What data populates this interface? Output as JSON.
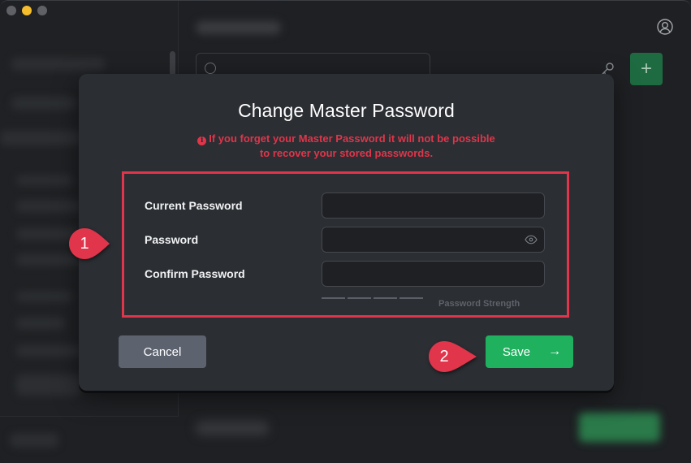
{
  "window": {
    "traffic_lights": [
      "close",
      "minimize",
      "maximize"
    ]
  },
  "background": {
    "icons": {
      "search": "search-icon",
      "user": "user-circle-icon",
      "key": "key-icon",
      "add": "plus-icon"
    },
    "add_button_label": "+"
  },
  "modal": {
    "title": "Change Master Password",
    "warning_icon": "i",
    "warning_line1": "If you forget your Master Password it will not be possible",
    "warning_line2": "to recover your stored passwords.",
    "fields": [
      {
        "label": "Current Password",
        "value": "",
        "placeholder": ""
      },
      {
        "label": "Password",
        "value": "",
        "placeholder": ""
      },
      {
        "label": "Confirm Password",
        "value": "",
        "placeholder": ""
      }
    ],
    "strength": {
      "label": "Password Strength",
      "segments": 4,
      "filled": 0
    },
    "cancel_label": "Cancel",
    "save_label": "Save",
    "save_arrow": "→"
  },
  "annotations": [
    {
      "number": "1",
      "color": "#e0354a"
    },
    {
      "number": "2",
      "color": "#e0354a"
    }
  ],
  "colors": {
    "accent_green": "#1fb15e",
    "warning_red": "#e0354a",
    "cancel_gray": "#5c636f"
  }
}
